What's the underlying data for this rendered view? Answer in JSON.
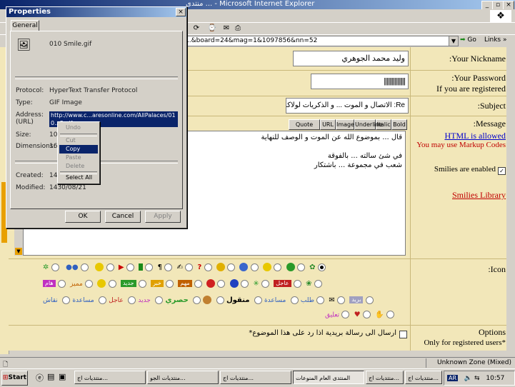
{
  "browser": {
    "title": "منتدى ... - Microsoft Internet Explorer",
    "address": "...&board=24&mag=1&1097856&nn=52",
    "go_label": "Go",
    "links_label": "Links",
    "status_zone": "Unknown Zone (Mixed)"
  },
  "form": {
    "nickname_label": ":Your Nickname",
    "nickname_value": "وليد محمد الجوهري",
    "password_label": ":Your Password",
    "password_value": "||||||||||||||||",
    "password_note": "If you are registered",
    "subject_label": ":Subject",
    "subject_value": "Re: الاتصال و الموت ... و الذكريات لولاكم  ~  صور",
    "message_label": ":Message",
    "html_note": "HTML is allowed",
    "markup_note": "You may use Markup Codes",
    "smilies_label": "Smilies are enabled",
    "smilies_link": "Smilies Library",
    "icon_label": ":Icon",
    "options_label": "Options",
    "options_note": "Only for registered users*",
    "notify_label": "ارسال الى رسالة بريدية اذا رد على هذا الموضوع*",
    "format_buttons": [
      "Bold",
      "Italic",
      "Underline",
      "Image",
      "URL",
      "Quote"
    ],
    "message_lines": [
      "قال ... بموضوع الله عن الموت و الوصف للنهاية",
      "",
      "في شئ سالته ... بالفوقة",
      "شعب في مجموعة ... باشتكار"
    ],
    "icon_tags_row2": [
      "هام",
      "جديد",
      "مميز",
      "خبر",
      "مهم",
      "عاجل",
      "رأي"
    ],
    "icon_text_row3": [
      "بريد",
      "نقاش",
      "مساعدة",
      "عاجل",
      "جديد",
      "حصري",
      "منقول",
      "مساعدة",
      "طلب"
    ],
    "icon_text_row4": [
      "تعليق"
    ]
  },
  "dialog": {
    "title": "Properties",
    "tab": "General",
    "file_name": "010 Smile.gif",
    "protocol_label": "Protocol:",
    "protocol_value": "HyperText Transfer Protocol",
    "type_label": "Type:",
    "type_value": "GIF Image",
    "address_label": "Address: (URL)",
    "address_value": "http://www.c...aresonline.com/AllPalaces/010...3.gif",
    "size_label": "Size:",
    "size_value": "10",
    "dimensions_label": "Dimensions:",
    "dimensions_value": "16",
    "created_label": "Created:",
    "created_value": "14",
    "modified_label": "Modified:",
    "modified_value": "1430/08/21",
    "ok": "OK",
    "cancel": "Cancel",
    "apply": "Apply"
  },
  "context_menu": {
    "items": [
      "Undo",
      "Cut",
      "Copy",
      "Paste",
      "Delete",
      "Select All"
    ],
    "highlighted": "Copy"
  },
  "taskbar": {
    "start": "Start",
    "tasks": [
      "منتديات اج...",
      "منتديات الجو...",
      "منتديات اج...",
      "المنتدى العام المنوعات",
      "منتديات اج...",
      "منتديات اج..."
    ],
    "active_index": 3,
    "clock": "10:57",
    "lang": "AR"
  }
}
